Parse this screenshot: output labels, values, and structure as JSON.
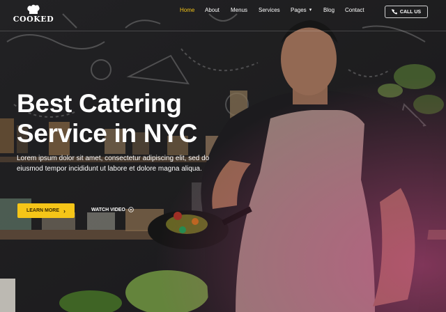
{
  "brand": {
    "name": "COOKED"
  },
  "nav": {
    "items": [
      {
        "label": "Home",
        "active": true
      },
      {
        "label": "About"
      },
      {
        "label": "Menus"
      },
      {
        "label": "Services"
      },
      {
        "label": "Pages",
        "has_dropdown": true
      },
      {
        "label": "Blog"
      },
      {
        "label": "Contact"
      }
    ],
    "cta": {
      "label": "CALL US",
      "icon": "phone-icon"
    }
  },
  "hero": {
    "title_line1": "Best Catering",
    "title_line2": "Service in NYC",
    "description": "Lorem ipsum dolor sit amet, consectetur adipiscing elit, sed do eiusmod tempor incididunt ut labore et dolore magna aliqua.",
    "primary_button": "LEARN MORE",
    "secondary_link": "WATCH VIDEO"
  },
  "colors": {
    "accent": "#f5c518",
    "background": "#1b1a1c",
    "text": "#ffffff"
  }
}
